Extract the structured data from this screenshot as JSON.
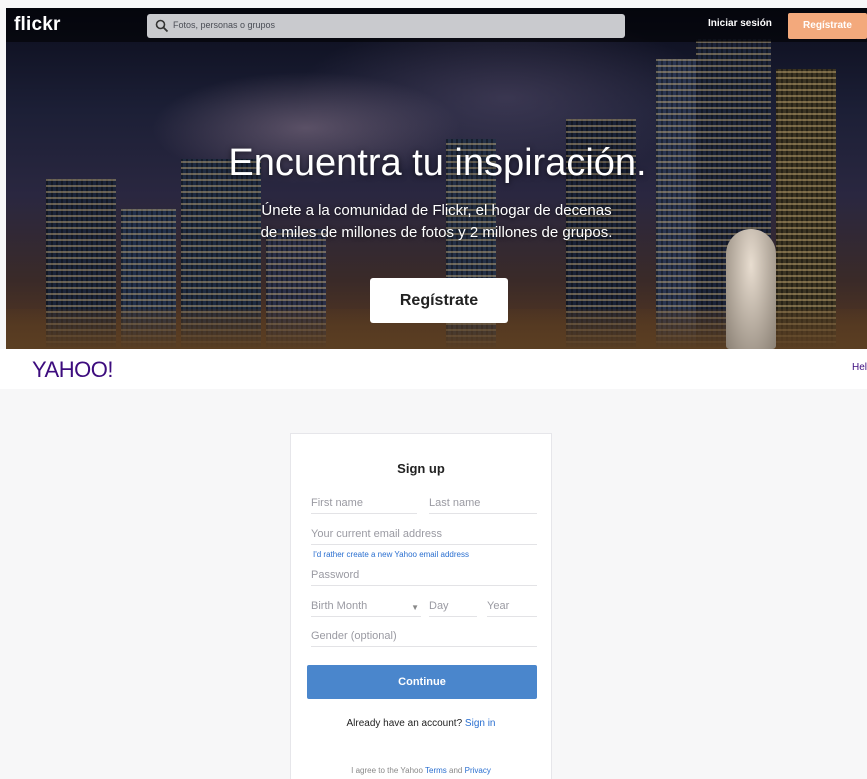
{
  "flickr": {
    "logo": "flickr",
    "search_placeholder": "Fotos, personas o grupos",
    "login": "Iniciar sesión",
    "signup_top": "Regístrate",
    "hero_title": "Encuentra tu inspiración.",
    "hero_subtitle_line1": "Únete a la comunidad de Flickr, el hogar de decenas",
    "hero_subtitle_line2": "de miles de millones de fotos y 2 millones de grupos.",
    "hero_button": "Regístrate",
    "accent": "#f3a97c"
  },
  "yahoo": {
    "logo": "YAHOO!",
    "help": "Hel",
    "brand_color": "#3d0c7e",
    "form": {
      "title": "Sign up",
      "first_name": "First name",
      "last_name": "Last name",
      "email": "Your current email address",
      "create_yahoo_link": "I'd rather create a new Yahoo email address",
      "password": "Password",
      "birth_month": "Birth Month",
      "day": "Day",
      "year": "Year",
      "gender": "Gender (optional)",
      "continue": "Continue",
      "already_text": "Already have an account?",
      "sign_in": "Sign in",
      "terms_prefix": "I agree to the Yahoo",
      "terms": "Terms",
      "and": "and",
      "privacy": "Privacy",
      "button_color": "#4a86cc"
    }
  }
}
